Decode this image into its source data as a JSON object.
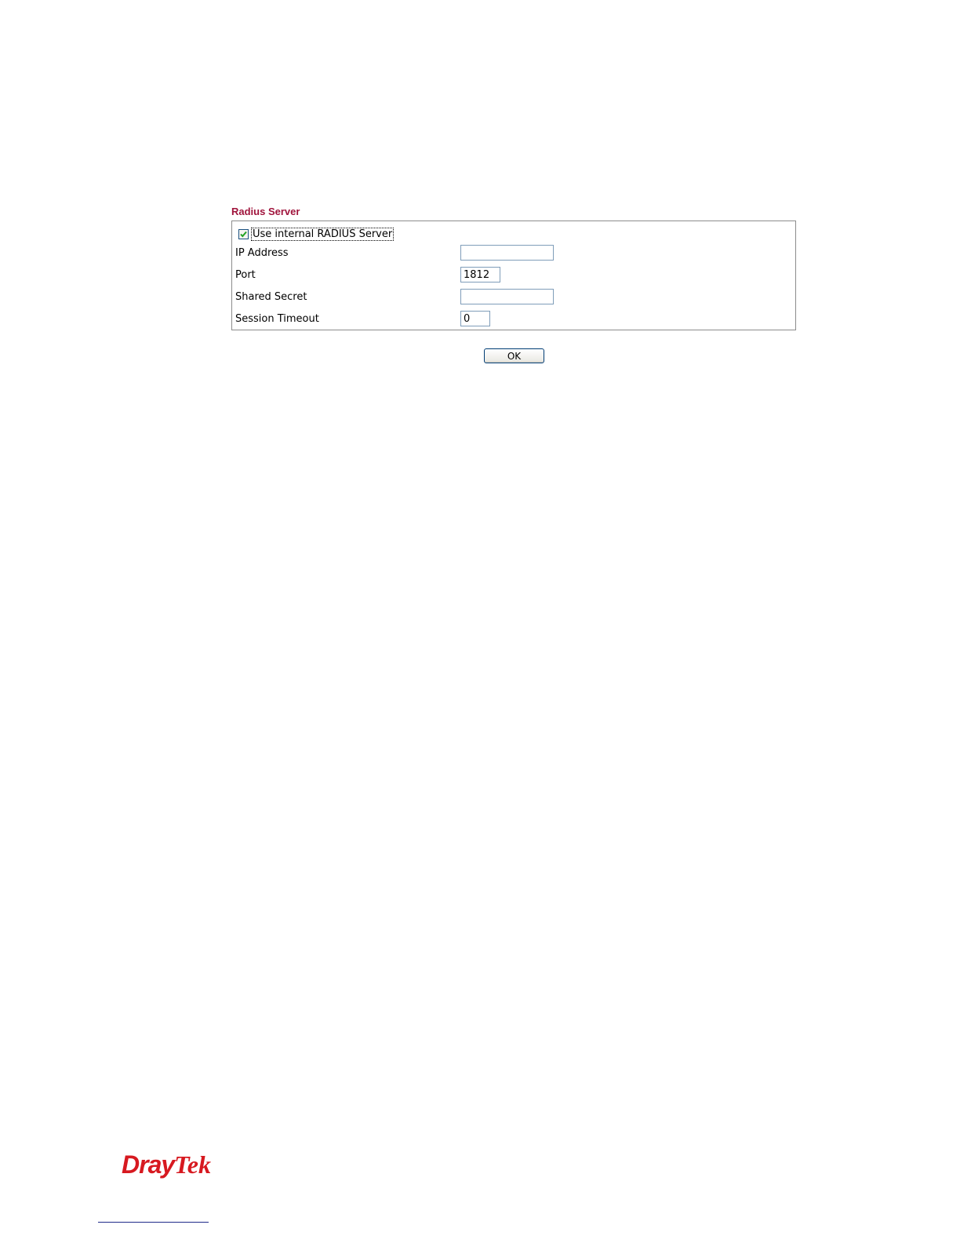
{
  "section": {
    "title": "Radius Server"
  },
  "form": {
    "use_internal": {
      "label": "Use internal RADIUS Server",
      "checked": true
    },
    "fields": [
      {
        "label": "IP Address",
        "value": ""
      },
      {
        "label": "Port",
        "value": "1812"
      },
      {
        "label": "Shared Secret",
        "value": ""
      },
      {
        "label": "Session Timeout",
        "value": "0"
      }
    ]
  },
  "ok_button": {
    "label": "OK"
  },
  "branding": {
    "logo_text_part1": "Dray",
    "logo_text_part2": "Tek",
    "logo_color": "#d71920",
    "title_color": "#a0143c"
  }
}
